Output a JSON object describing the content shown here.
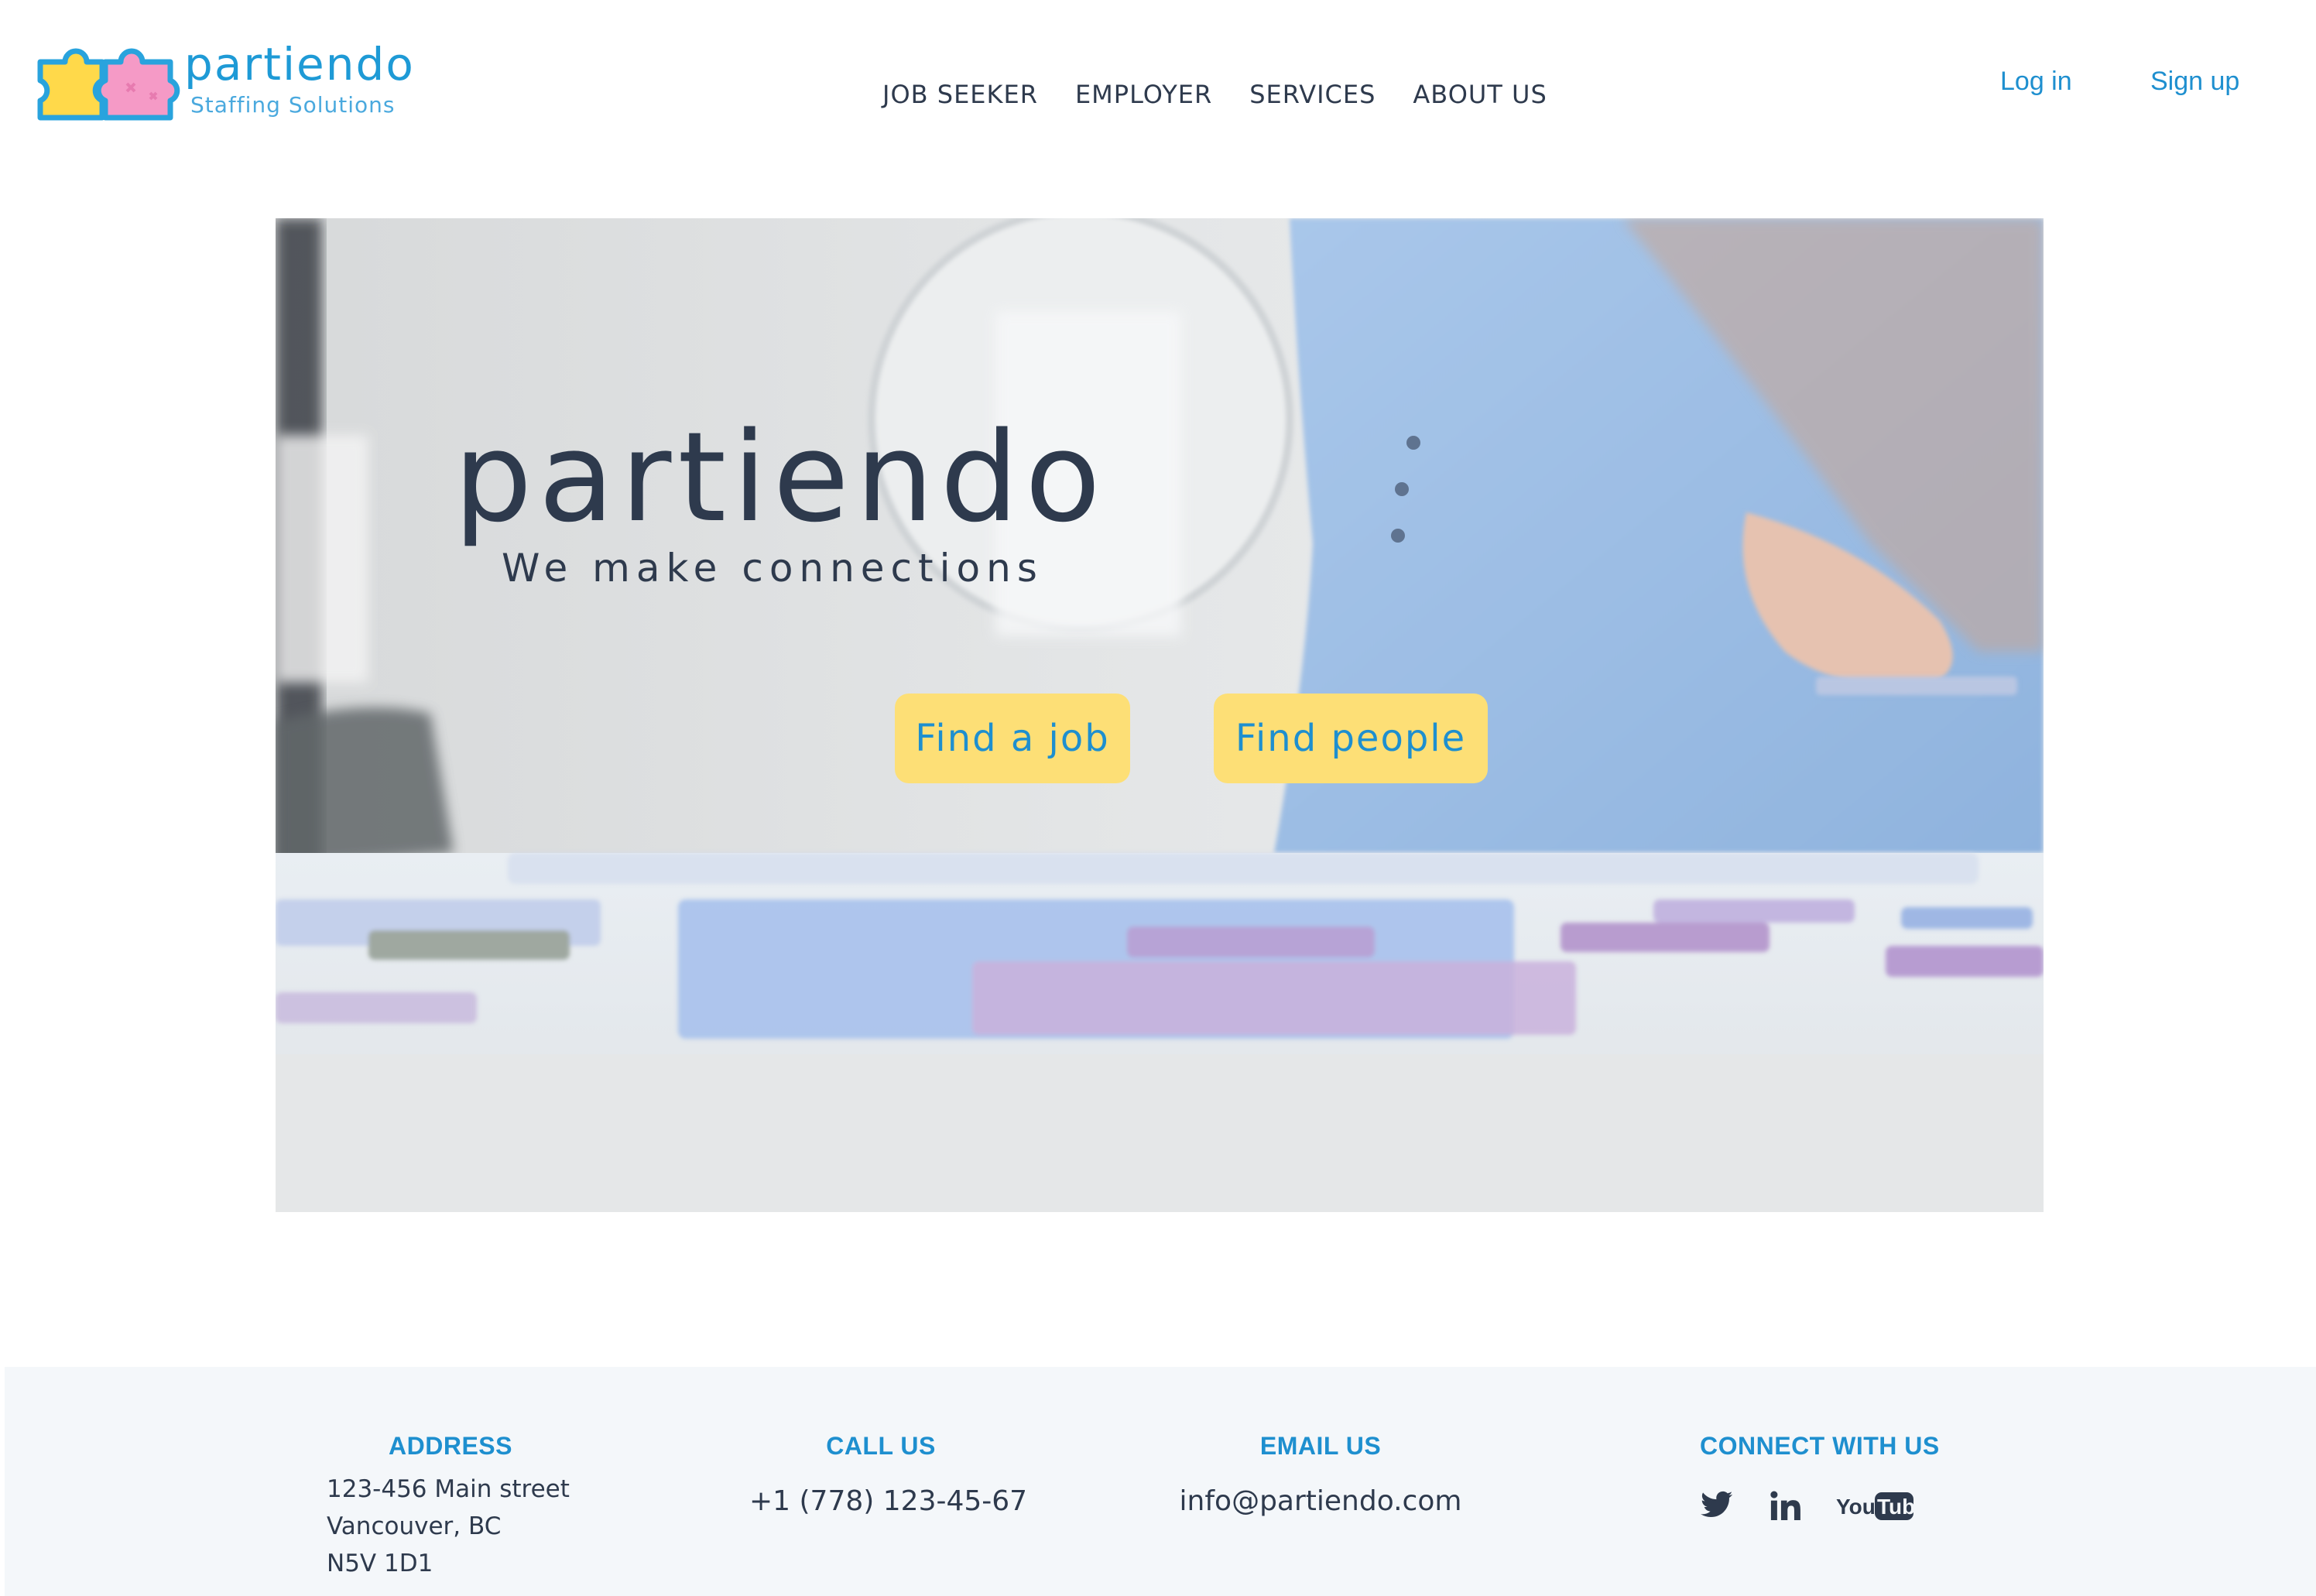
{
  "brand": {
    "name": "partiendo",
    "tagline": "Staffing Solutions"
  },
  "nav": {
    "items": [
      {
        "label": "JOB SEEKER"
      },
      {
        "label": "EMPLOYER"
      },
      {
        "label": "SERVICES"
      },
      {
        "label": "ABOUT US"
      }
    ]
  },
  "auth": {
    "login_label": "Log in",
    "signup_label": "Sign up"
  },
  "hero": {
    "title": "partiendo",
    "tagline": "We make connections",
    "buttons": {
      "find_job": "Find a job",
      "find_people": "Find people"
    }
  },
  "footer": {
    "address": {
      "heading": "ADDRESS",
      "line1": "123-456 Main street",
      "line2": "Vancouver, BC",
      "line3": "N5V 1D1"
    },
    "call": {
      "heading": "CALL US",
      "phone": "+1 (778) 123-45-67"
    },
    "email": {
      "heading": "EMAIL US",
      "address": "info@partiendo.com"
    },
    "social": {
      "heading": "CONNECT WITH US",
      "icons": [
        "twitter-icon",
        "linkedin-icon",
        "youtube-icon"
      ]
    }
  },
  "colors": {
    "brand_blue": "#1e9ad6",
    "text_dark": "#2e3a4d",
    "cta_yellow": "#fddf76",
    "footer_bg": "#f4f7fa"
  }
}
